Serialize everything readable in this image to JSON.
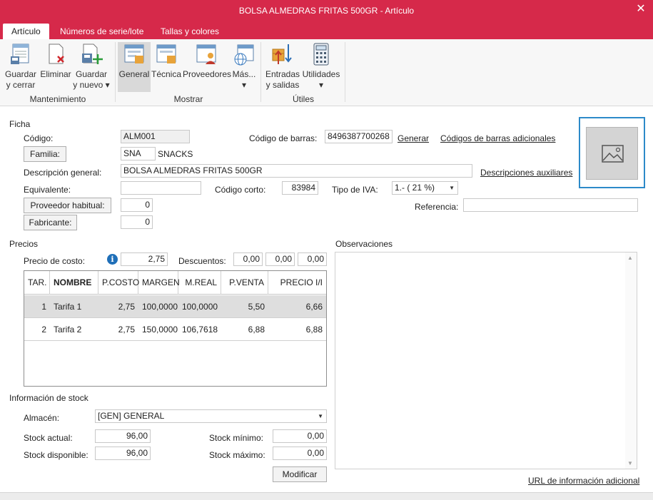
{
  "window": {
    "title": "BOLSA ALMEDRAS FRITAS 500GR - Artículo",
    "close_label": "✕"
  },
  "tabs": [
    {
      "label": "Artículo",
      "active": true
    },
    {
      "label": "Números de serie/lote",
      "active": false
    },
    {
      "label": "Tallas y colores",
      "active": false
    }
  ],
  "ribbon": {
    "groups": {
      "mantenimiento": "Mantenimiento",
      "mostrar": "Mostrar",
      "utiles": "Útiles"
    },
    "buttons": {
      "guardar_cerrar": {
        "line1": "Guardar",
        "line2": "y cerrar"
      },
      "eliminar": {
        "line1": "Eliminar"
      },
      "guardar_nuevo": {
        "line1": "Guardar",
        "line2": "y nuevo ▾"
      },
      "general": {
        "line1": "General"
      },
      "tecnica": {
        "line1": "Técnica"
      },
      "proveedores": {
        "line1": "Proveedores"
      },
      "mas": {
        "line1": "Más...",
        "line2": "▾"
      },
      "entradas_salidas": {
        "line1": "Entradas",
        "line2": "y salidas"
      },
      "utilidades": {
        "line1": "Utilidades",
        "line2": "▾"
      }
    }
  },
  "ficha": {
    "section": "Ficha",
    "codigo_label": "Código:",
    "codigo_value": "ALM001",
    "familia_button": "Familia:",
    "familia_code": "SNA",
    "familia_name": "SNACKS",
    "descripcion_label": "Descripción general:",
    "descripcion_value": "BOLSA ALMEDRAS FRITAS 500GR",
    "equivalente_label": "Equivalente:",
    "equivalente_value": "",
    "proveedor_button": "Proveedor habitual:",
    "proveedor_value": "0",
    "fabricante_button": "Fabricante:",
    "fabricante_value": "0",
    "codigo_barras_label": "Código de barras:",
    "codigo_barras_value": "8496387700268",
    "generar_link": "Generar",
    "codigos_adicionales_link": "Códigos de barras adicionales",
    "descripciones_aux_link": "Descripciones auxiliares",
    "codigo_corto_label": "Código corto:",
    "codigo_corto_value": "83984",
    "tipo_iva_label": "Tipo de IVA:",
    "tipo_iva_value": "1.- ( 21 %)",
    "referencia_label": "Referencia:",
    "referencia_value": ""
  },
  "precios": {
    "section": "Precios",
    "precio_costo_label": "Precio de costo:",
    "precio_costo_value": "2,75",
    "descuentos_label": "Descuentos:",
    "descuentos": [
      "0,00",
      "0,00",
      "0,00"
    ],
    "columns": [
      "TAR.",
      "NOMBRE",
      "P.COSTO",
      "MARGEN",
      "M.REAL",
      "P.VENTA",
      "PRECIO I/I"
    ],
    "rows": [
      {
        "tar": "1",
        "nombre": "Tarifa 1",
        "pcosto": "2,75",
        "margen": "100,0000",
        "mreal": "100,0000",
        "pventa": "5,50",
        "precio_ii": "6,66"
      },
      {
        "tar": "2",
        "nombre": "Tarifa 2",
        "pcosto": "2,75",
        "margen": "150,0000",
        "mreal": "106,7618",
        "pventa": "6,88",
        "precio_ii": "6,88"
      }
    ]
  },
  "observaciones": {
    "section": "Observaciones",
    "url_link": "URL de información adicional"
  },
  "stock": {
    "section": "Información de stock",
    "almacen_label": "Almacén:",
    "almacen_value": "[GEN] GENERAL",
    "stock_actual_label": "Stock actual:",
    "stock_actual_value": "96,00",
    "stock_disponible_label": "Stock disponible:",
    "stock_disponible_value": "96,00",
    "stock_minimo_label": "Stock mínimo:",
    "stock_minimo_value": "0,00",
    "stock_maximo_label": "Stock máximo:",
    "stock_maximo_value": "0,00",
    "modificar_button": "Modificar"
  },
  "colors": {
    "brand": "#d6294a",
    "image_frame": "#2d8ac9",
    "info": "#1f6fb8"
  }
}
